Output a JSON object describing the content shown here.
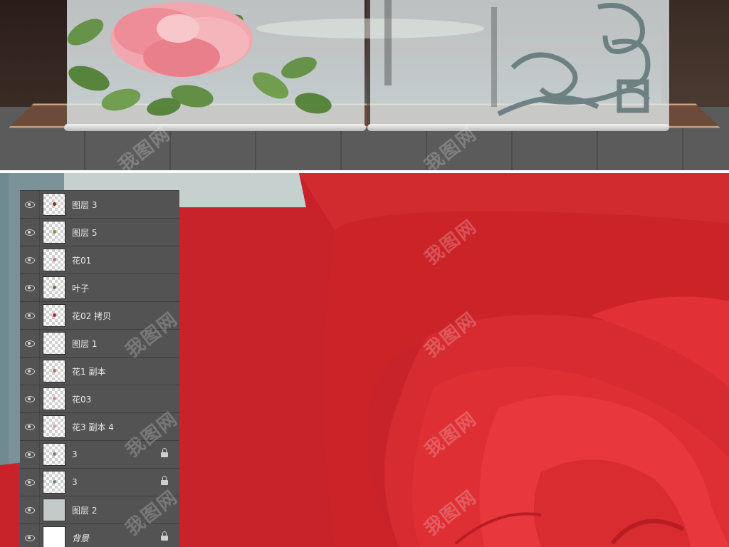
{
  "watermark": "我图网",
  "layers": [
    {
      "name": "图层 3",
      "thumb": "transparent",
      "locked": false,
      "visible": true,
      "thumb_mark": "#8b2a1c"
    },
    {
      "name": "图层 5",
      "thumb": "transparent",
      "locked": false,
      "visible": true,
      "thumb_mark": "#7a9a3a"
    },
    {
      "name": "花01",
      "thumb": "transparent",
      "locked": false,
      "visible": true,
      "thumb_mark": "#e06a7a"
    },
    {
      "name": "叶子",
      "thumb": "transparent",
      "locked": false,
      "visible": true,
      "thumb_mark": "#4e8a3a"
    },
    {
      "name": "花02 拷贝",
      "thumb": "transparent",
      "locked": false,
      "visible": true,
      "thumb_mark": "#c81f24"
    },
    {
      "name": "图层 1",
      "thumb": "transparent",
      "locked": false,
      "visible": true,
      "thumb_mark": ""
    },
    {
      "name": "花1 副本",
      "thumb": "transparent",
      "locked": false,
      "visible": true,
      "thumb_mark": "#d76a5f"
    },
    {
      "name": "花03",
      "thumb": "transparent",
      "locked": false,
      "visible": true,
      "thumb_mark": "#e38b94"
    },
    {
      "name": "花3 副本 4",
      "thumb": "transparent",
      "locked": false,
      "visible": true,
      "thumb_mark": "#e8a0a6"
    },
    {
      "name": "3",
      "thumb": "transparent",
      "locked": true,
      "visible": true,
      "thumb_mark": "#6f8a90"
    },
    {
      "name": "3",
      "thumb": "transparent",
      "locked": true,
      "visible": true,
      "thumb_mark": "#6f8a90"
    },
    {
      "name": "图层 2",
      "thumb": "solid-gray",
      "locked": false,
      "visible": true,
      "thumb_mark": ""
    },
    {
      "name": "背景",
      "thumb": "solid-white",
      "locked": true,
      "visible": true,
      "thumb_mark": ""
    }
  ],
  "colors": {
    "panel_bg": "#535353",
    "rose_red": "#d32a2e",
    "background_gray": "#c6d0cf",
    "teal": "#6f8a90"
  },
  "icons": {
    "visibility": "eye-icon",
    "lock": "lock-icon"
  }
}
